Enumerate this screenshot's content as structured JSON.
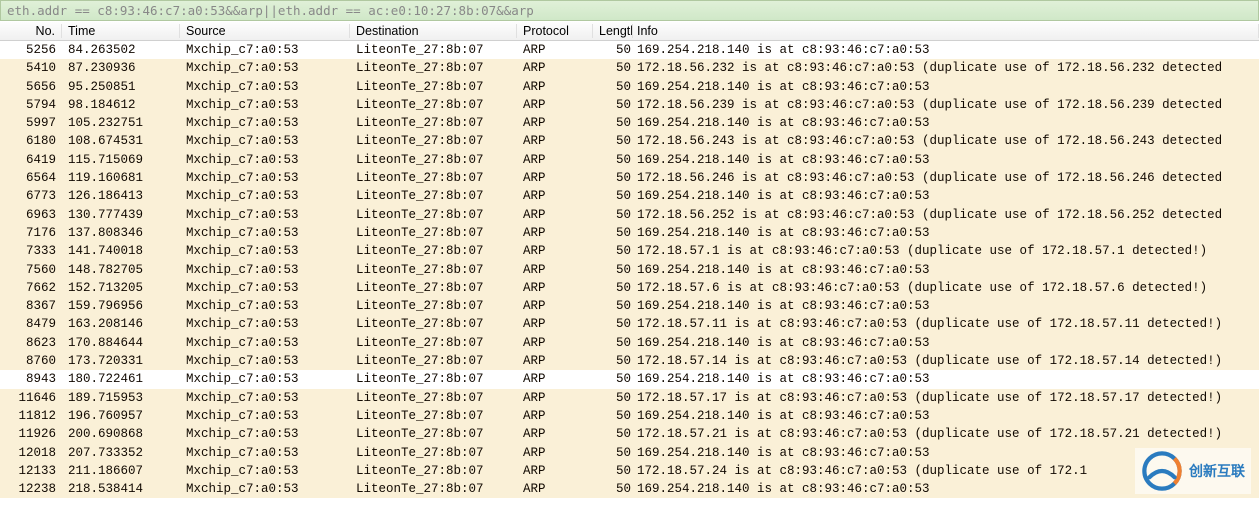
{
  "filter_text": "eth.addr == c8:93:46:c7:a0:53&&arp||eth.addr == ac:e0:10:27:8b:07&&arp",
  "columns": {
    "no": "No.",
    "time": "Time",
    "source": "Source",
    "destination": "Destination",
    "protocol": "Protocol",
    "length": "Length",
    "info": "Info"
  },
  "packets": [
    {
      "no": "5256",
      "time": "84.263502",
      "src": "Mxchip_c7:a0:53",
      "dst": "LiteonTe_27:8b:07",
      "prot": "ARP",
      "len": "50",
      "info": "169.254.218.140 is at c8:93:46:c7:a0:53",
      "sel": true
    },
    {
      "no": "5410",
      "time": "87.230936",
      "src": "Mxchip_c7:a0:53",
      "dst": "LiteonTe_27:8b:07",
      "prot": "ARP",
      "len": "50",
      "info": "172.18.56.232 is at c8:93:46:c7:a0:53 (duplicate use of 172.18.56.232 detected"
    },
    {
      "no": "5656",
      "time": "95.250851",
      "src": "Mxchip_c7:a0:53",
      "dst": "LiteonTe_27:8b:07",
      "prot": "ARP",
      "len": "50",
      "info": "169.254.218.140 is at c8:93:46:c7:a0:53"
    },
    {
      "no": "5794",
      "time": "98.184612",
      "src": "Mxchip_c7:a0:53",
      "dst": "LiteonTe_27:8b:07",
      "prot": "ARP",
      "len": "50",
      "info": "172.18.56.239 is at c8:93:46:c7:a0:53 (duplicate use of 172.18.56.239 detected"
    },
    {
      "no": "5997",
      "time": "105.232751",
      "src": "Mxchip_c7:a0:53",
      "dst": "LiteonTe_27:8b:07",
      "prot": "ARP",
      "len": "50",
      "info": "169.254.218.140 is at c8:93:46:c7:a0:53"
    },
    {
      "no": "6180",
      "time": "108.674531",
      "src": "Mxchip_c7:a0:53",
      "dst": "LiteonTe_27:8b:07",
      "prot": "ARP",
      "len": "50",
      "info": "172.18.56.243 is at c8:93:46:c7:a0:53 (duplicate use of 172.18.56.243 detected"
    },
    {
      "no": "6419",
      "time": "115.715069",
      "src": "Mxchip_c7:a0:53",
      "dst": "LiteonTe_27:8b:07",
      "prot": "ARP",
      "len": "50",
      "info": "169.254.218.140 is at c8:93:46:c7:a0:53"
    },
    {
      "no": "6564",
      "time": "119.160681",
      "src": "Mxchip_c7:a0:53",
      "dst": "LiteonTe_27:8b:07",
      "prot": "ARP",
      "len": "50",
      "info": "172.18.56.246 is at c8:93:46:c7:a0:53 (duplicate use of 172.18.56.246 detected"
    },
    {
      "no": "6773",
      "time": "126.186413",
      "src": "Mxchip_c7:a0:53",
      "dst": "LiteonTe_27:8b:07",
      "prot": "ARP",
      "len": "50",
      "info": "169.254.218.140 is at c8:93:46:c7:a0:53"
    },
    {
      "no": "6963",
      "time": "130.777439",
      "src": "Mxchip_c7:a0:53",
      "dst": "LiteonTe_27:8b:07",
      "prot": "ARP",
      "len": "50",
      "info": "172.18.56.252 is at c8:93:46:c7:a0:53 (duplicate use of 172.18.56.252 detected"
    },
    {
      "no": "7176",
      "time": "137.808346",
      "src": "Mxchip_c7:a0:53",
      "dst": "LiteonTe_27:8b:07",
      "prot": "ARP",
      "len": "50",
      "info": "169.254.218.140 is at c8:93:46:c7:a0:53"
    },
    {
      "no": "7333",
      "time": "141.740018",
      "src": "Mxchip_c7:a0:53",
      "dst": "LiteonTe_27:8b:07",
      "prot": "ARP",
      "len": "50",
      "info": "172.18.57.1 is at c8:93:46:c7:a0:53 (duplicate use of 172.18.57.1 detected!)"
    },
    {
      "no": "7560",
      "time": "148.782705",
      "src": "Mxchip_c7:a0:53",
      "dst": "LiteonTe_27:8b:07",
      "prot": "ARP",
      "len": "50",
      "info": "169.254.218.140 is at c8:93:46:c7:a0:53"
    },
    {
      "no": "7662",
      "time": "152.713205",
      "src": "Mxchip_c7:a0:53",
      "dst": "LiteonTe_27:8b:07",
      "prot": "ARP",
      "len": "50",
      "info": "172.18.57.6 is at c8:93:46:c7:a0:53 (duplicate use of 172.18.57.6 detected!)"
    },
    {
      "no": "8367",
      "time": "159.796956",
      "src": "Mxchip_c7:a0:53",
      "dst": "LiteonTe_27:8b:07",
      "prot": "ARP",
      "len": "50",
      "info": "169.254.218.140 is at c8:93:46:c7:a0:53"
    },
    {
      "no": "8479",
      "time": "163.208146",
      "src": "Mxchip_c7:a0:53",
      "dst": "LiteonTe_27:8b:07",
      "prot": "ARP",
      "len": "50",
      "info": "172.18.57.11 is at c8:93:46:c7:a0:53 (duplicate use of 172.18.57.11 detected!)"
    },
    {
      "no": "8623",
      "time": "170.884644",
      "src": "Mxchip_c7:a0:53",
      "dst": "LiteonTe_27:8b:07",
      "prot": "ARP",
      "len": "50",
      "info": "169.254.218.140 is at c8:93:46:c7:a0:53"
    },
    {
      "no": "8760",
      "time": "173.720331",
      "src": "Mxchip_c7:a0:53",
      "dst": "LiteonTe_27:8b:07",
      "prot": "ARP",
      "len": "50",
      "info": "172.18.57.14 is at c8:93:46:c7:a0:53 (duplicate use of 172.18.57.14 detected!)"
    },
    {
      "no": "8943",
      "time": "180.722461",
      "src": "Mxchip_c7:a0:53",
      "dst": "LiteonTe_27:8b:07",
      "prot": "ARP",
      "len": "50",
      "info": "169.254.218.140 is at c8:93:46:c7:a0:53",
      "sel": true
    },
    {
      "no": "11646",
      "time": "189.715953",
      "src": "Mxchip_c7:a0:53",
      "dst": "LiteonTe_27:8b:07",
      "prot": "ARP",
      "len": "50",
      "info": "172.18.57.17 is at c8:93:46:c7:a0:53 (duplicate use of 172.18.57.17 detected!)"
    },
    {
      "no": "11812",
      "time": "196.760957",
      "src": "Mxchip_c7:a0:53",
      "dst": "LiteonTe_27:8b:07",
      "prot": "ARP",
      "len": "50",
      "info": "169.254.218.140 is at c8:93:46:c7:a0:53"
    },
    {
      "no": "11926",
      "time": "200.690868",
      "src": "Mxchip_c7:a0:53",
      "dst": "LiteonTe_27:8b:07",
      "prot": "ARP",
      "len": "50",
      "info": "172.18.57.21 is at c8:93:46:c7:a0:53 (duplicate use of 172.18.57.21 detected!)"
    },
    {
      "no": "12018",
      "time": "207.733352",
      "src": "Mxchip_c7:a0:53",
      "dst": "LiteonTe_27:8b:07",
      "prot": "ARP",
      "len": "50",
      "info": "169.254.218.140 is at c8:93:46:c7:a0:53"
    },
    {
      "no": "12133",
      "time": "211.186607",
      "src": "Mxchip_c7:a0:53",
      "dst": "LiteonTe_27:8b:07",
      "prot": "ARP",
      "len": "50",
      "info": "172.18.57.24 is at c8:93:46:c7:a0:53 (duplicate use of 172.1"
    },
    {
      "no": "12238",
      "time": "218.538414",
      "src": "Mxchip_c7:a0:53",
      "dst": "LiteonTe_27:8b:07",
      "prot": "ARP",
      "len": "50",
      "info": "169.254.218.140 is at c8:93:46:c7:a0:53"
    }
  ],
  "watermark": {
    "text": "创新互联"
  }
}
